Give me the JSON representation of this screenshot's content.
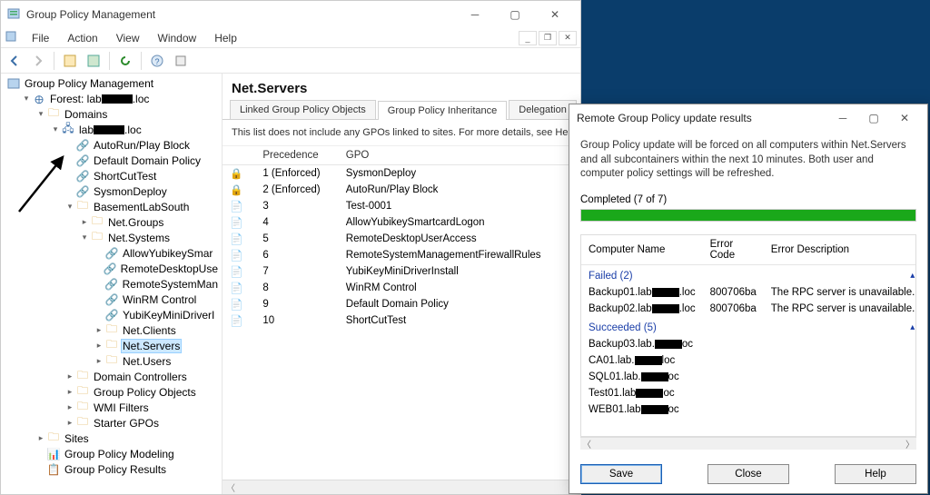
{
  "window": {
    "title": "Group Policy Management",
    "menus": [
      "File",
      "Action",
      "View",
      "Window",
      "Help"
    ]
  },
  "tree": {
    "root": "Group Policy Management",
    "forest_prefix": "Forest: lab",
    "forest_suffix": ".loc",
    "domains": "Domains",
    "domain_prefix": "lab",
    "domain_suffix": ".loc",
    "gpo1": "AutoRun/Play Block",
    "gpo2": "Default Domain Policy",
    "gpo3": "ShortCutTest",
    "gpo4": "SysmonDeploy",
    "ou1": "BasementLabSouth",
    "netgroups": "Net.Groups",
    "netsystems": "Net.Systems",
    "sys1": "AllowYubikeySmar",
    "sys2": "RemoteDesktopUse",
    "sys3": "RemoteSystemMan",
    "sys4": "WinRM Control",
    "sys5": "YubiKeyMiniDriverI",
    "netclients": "Net.Clients",
    "netservers": "Net.Servers",
    "netusers": "Net.Users",
    "dc": "Domain Controllers",
    "gpoContainer": "Group Policy Objects",
    "wmi": "WMI Filters",
    "starter": "Starter GPOs",
    "sites": "Sites",
    "modeling": "Group Policy Modeling",
    "results": "Group Policy Results"
  },
  "details": {
    "heading": "Net.Servers",
    "tabs": [
      "Linked Group Policy Objects",
      "Group Policy Inheritance",
      "Delegation"
    ],
    "subtext": "This list does not include any GPOs linked to sites. For more details, see He",
    "columns": [
      "Precedence",
      "GPO"
    ],
    "rows": [
      {
        "prec": "1 (Enforced)",
        "name": "SysmonDeploy",
        "lock": true
      },
      {
        "prec": "2 (Enforced)",
        "name": "AutoRun/Play Block",
        "lock": true
      },
      {
        "prec": "3",
        "name": "Test-0001",
        "lock": false
      },
      {
        "prec": "4",
        "name": "AllowYubikeySmartcardLogon",
        "lock": false
      },
      {
        "prec": "5",
        "name": "RemoteDesktopUserAccess",
        "lock": false
      },
      {
        "prec": "6",
        "name": "RemoteSystemManagementFirewallRules",
        "lock": false
      },
      {
        "prec": "7",
        "name": "YubiKeyMiniDriverInstall",
        "lock": false
      },
      {
        "prec": "8",
        "name": "WinRM Control",
        "lock": false
      },
      {
        "prec": "9",
        "name": "Default Domain Policy",
        "lock": false
      },
      {
        "prec": "10",
        "name": "ShortCutTest",
        "lock": false
      }
    ]
  },
  "dialog": {
    "title": "Remote Group Policy update results",
    "desc": "Group Policy update will be forced on all computers within Net.Servers and all subcontainers within the next 10 minutes. Both user and computer policy settings will be refreshed.",
    "progress": "Completed (7 of 7)",
    "columns": [
      "Computer Name",
      "Error Code",
      "Error Description"
    ],
    "failed_label": "Failed (2)",
    "failed": [
      {
        "name_pre": "Backup01.lab",
        "name_post": ".loc",
        "code": "800706ba",
        "err": "The RPC server is unavailable."
      },
      {
        "name_pre": "Backup02.lab",
        "name_post": ".loc",
        "code": "800706ba",
        "err": "The RPC server is unavailable."
      }
    ],
    "succeeded_label": "Succeeded (5)",
    "succeeded": [
      {
        "name_pre": "Backup03.lab.",
        "name_post": "oc"
      },
      {
        "name_pre": "CA01.lab.",
        "name_post": "loc"
      },
      {
        "name_pre": "SQL01.lab.",
        "name_post": "oc"
      },
      {
        "name_pre": "Test01.lab",
        "name_post": "oc"
      },
      {
        "name_pre": "WEB01.lab",
        "name_post": "oc"
      }
    ],
    "buttons": {
      "save": "Save",
      "close": "Close",
      "help": "Help"
    }
  }
}
